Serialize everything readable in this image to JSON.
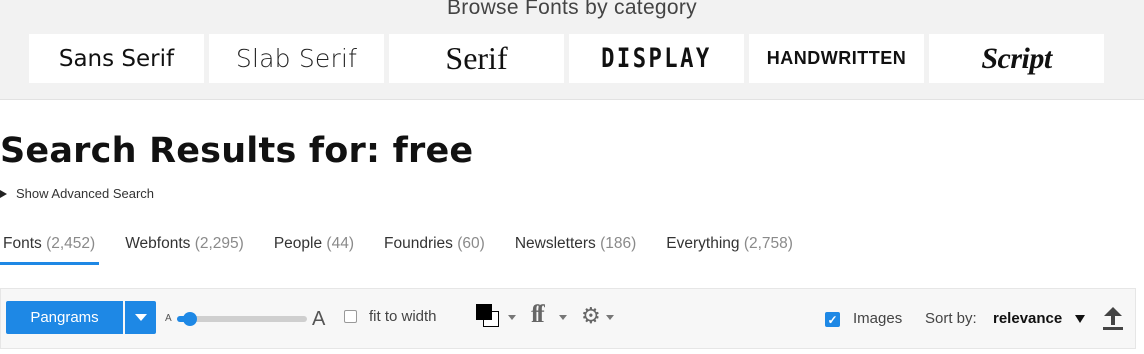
{
  "categories": {
    "heading": "Browse Fonts by category",
    "items": [
      {
        "label": "Sans Serif"
      },
      {
        "label": "Slab Serif"
      },
      {
        "label": "Serif"
      },
      {
        "label": "DISPLAY"
      },
      {
        "label": "HANDWRITTEN"
      },
      {
        "label": "Script"
      }
    ]
  },
  "search": {
    "title": "Search Results for: free",
    "advanced_toggle": "Show Advanced Search"
  },
  "tabs": [
    {
      "label": "Fonts",
      "count": "(2,452)",
      "active": true
    },
    {
      "label": "Webfonts",
      "count": "(2,295)",
      "active": false
    },
    {
      "label": "People",
      "count": "(44)",
      "active": false
    },
    {
      "label": "Foundries",
      "count": "(60)",
      "active": false
    },
    {
      "label": "Newsletters",
      "count": "(186)",
      "active": false
    },
    {
      "label": "Everything",
      "count": "(2,758)",
      "active": false
    }
  ],
  "toolbar": {
    "preview_button": "Pangrams",
    "size_small_label": "A",
    "size_large_label": "A",
    "size_slider_fraction": 0.1,
    "fit_to_width_label": "fit to width",
    "fit_to_width_checked": false,
    "color_icon": "color-swatch-icon",
    "font_features_icon": "ff",
    "settings_icon": "gear-icon",
    "settings_glyph": "⚙",
    "images_label": "Images",
    "images_checked": true,
    "images_check_glyph": "✓",
    "sort_label": "Sort by:",
    "sort_value": "relevance",
    "sort_direction_icon": "upload-arrow-icon"
  },
  "colors": {
    "accent": "#1e88e5",
    "band_background": "#f2f2f2",
    "toolbar_background": "#f7f7f7"
  }
}
